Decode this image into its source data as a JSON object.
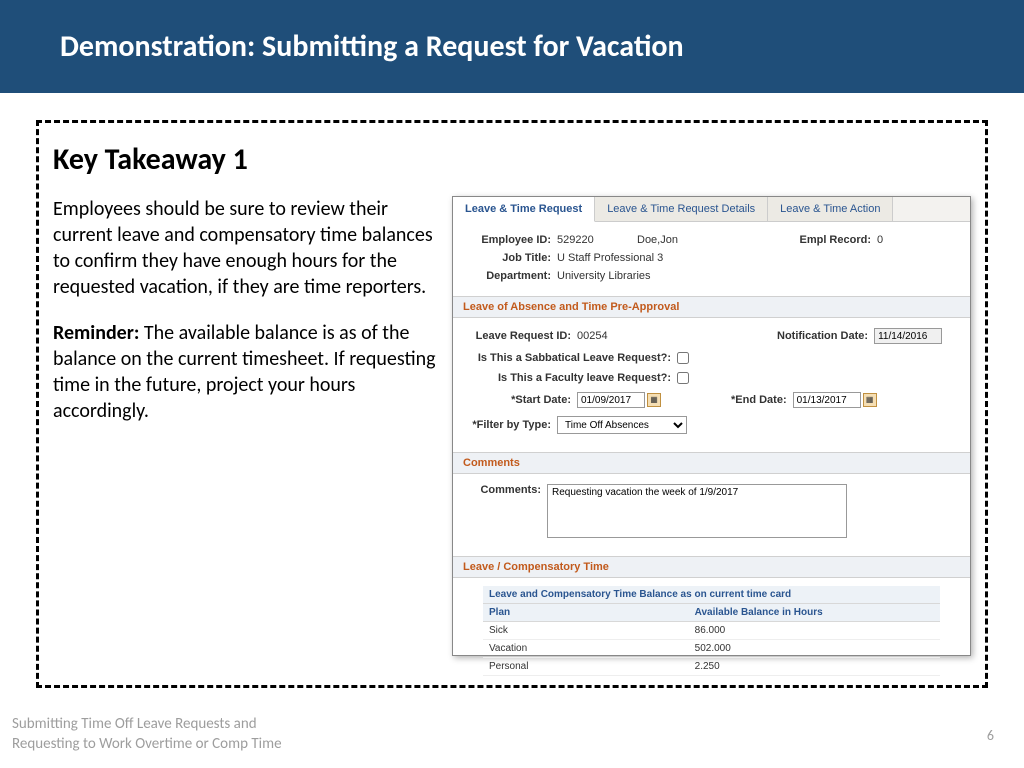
{
  "header": {
    "title": "Demonstration: Submitting a Request for Vacation"
  },
  "takeaway": {
    "title": "Key Takeaway 1",
    "para1": "Employees should be sure to review their current leave and compensatory time balances to confirm they have enough hours for the requested vacation, if they are time reporters.",
    "reminder_label": "Reminder:",
    "reminder_text": " The available balance is as of the balance on the current timesheet. If requesting time in the future, project your hours accordingly."
  },
  "app": {
    "tabs": [
      "Leave & Time Request",
      "Leave & Time Request Details",
      "Leave & Time Action"
    ],
    "employee": {
      "id_label": "Employee ID:",
      "id": "529220",
      "name": "Doe,Jon",
      "record_label": "Empl Record:",
      "record": "0",
      "job_label": "Job Title:",
      "job": "U Staff Professional 3",
      "dept_label": "Department:",
      "dept": "University Libraries"
    },
    "preapproval": {
      "header": "Leave of Absence and Time Pre-Approval",
      "req_id_label": "Leave Request ID:",
      "req_id": "00254",
      "notif_label": "Notification Date:",
      "notif_date": "11/14/2016",
      "sabbatical_label": "Is This a Sabbatical Leave Request?:",
      "faculty_label": "Is This a Faculty leave Request?:",
      "start_label": "*Start Date:",
      "start_date": "01/09/2017",
      "end_label": "*End Date:",
      "end_date": "01/13/2017",
      "filter_label": "*Filter by Type:",
      "filter_value": "Time Off Absences"
    },
    "comments": {
      "header": "Comments",
      "label": "Comments:",
      "text": "Requesting vacation the week of 1/9/2017"
    },
    "balances": {
      "header": "Leave / Compensatory Time",
      "caption": "Leave and Compensatory Time Balance as on current time card",
      "cols": [
        "Plan",
        "Available Balance in Hours"
      ],
      "rows": [
        {
          "plan": "Sick",
          "hours": "86.000"
        },
        {
          "plan": "Vacation",
          "hours": "502.000"
        },
        {
          "plan": "Personal",
          "hours": "2.250"
        }
      ]
    }
  },
  "footer": {
    "left1": "Submitting Time Off Leave Requests and",
    "left2": "Requesting to Work Overtime or Comp Time",
    "page": "6"
  }
}
